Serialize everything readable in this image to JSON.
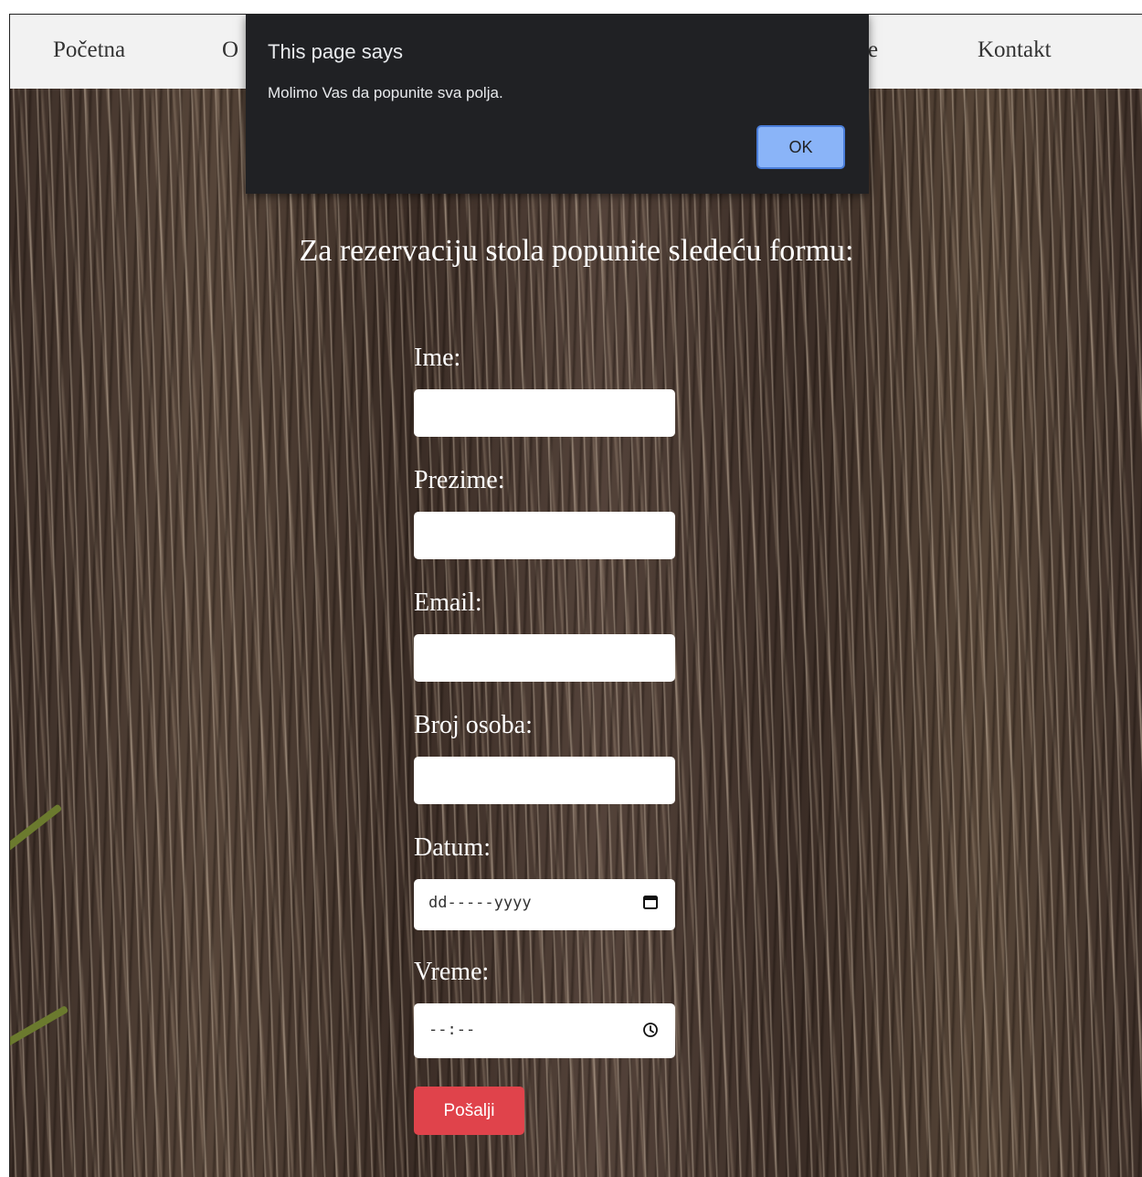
{
  "nav": {
    "items": [
      "Početna",
      "O",
      "je",
      "Kontakt"
    ]
  },
  "dialog": {
    "title": "This page says",
    "message": "Molimo Vas da popunite sva polja.",
    "ok_label": "OK"
  },
  "page": {
    "subtitle": "Za rezervaciju stola popunite sledeću formu:"
  },
  "form": {
    "ime_label": "Ime:",
    "prezime_label": "Prezime:",
    "email_label": "Email:",
    "broj_osoba_label": "Broj osoba:",
    "datum_label": "Datum:",
    "datum_placeholder": "dd-----yyyy",
    "vreme_label": "Vreme:",
    "vreme_placeholder": "--:--",
    "submit_label": "Pošalji"
  },
  "colors": {
    "navbar_bg": "#f2f2f2",
    "dialog_bg": "#202124",
    "ok_button": "#8ab4f8",
    "submit_button": "#e0434b"
  }
}
